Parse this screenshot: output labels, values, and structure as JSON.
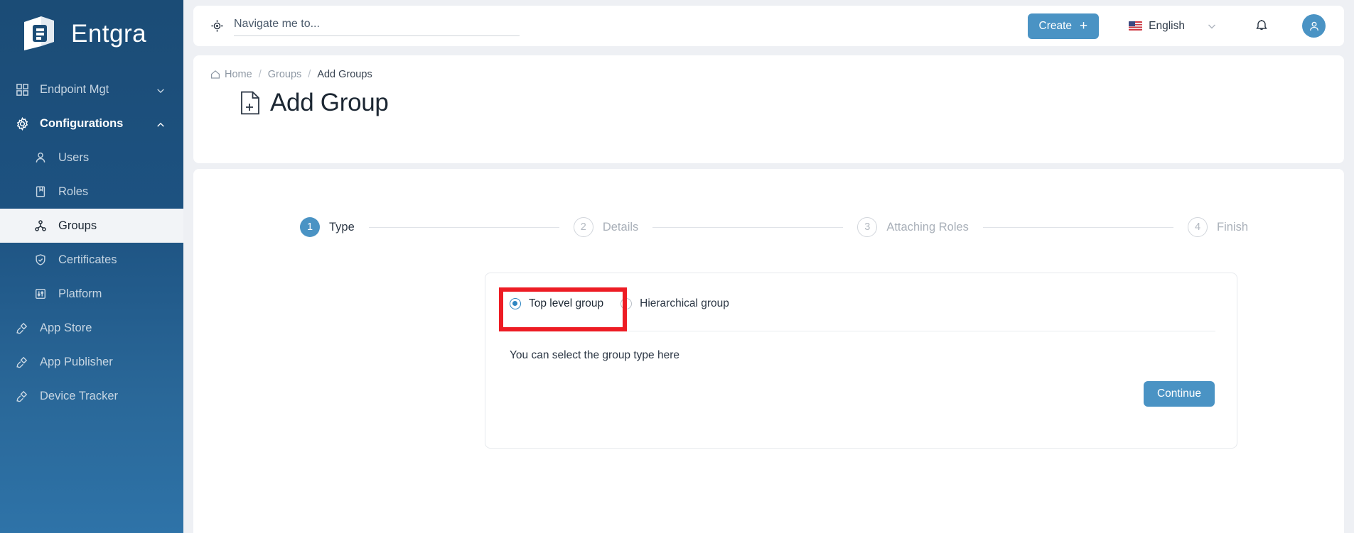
{
  "brand": {
    "name": "Entgra",
    "logo_icon": "entgra-cube-logo"
  },
  "sidebar": {
    "items": [
      {
        "label": "Endpoint Mgt",
        "icon": "grid-icon",
        "level": "top",
        "state": "collapsed",
        "chevron": "chevron-down-icon"
      },
      {
        "label": "Configurations",
        "icon": "gear-icon",
        "level": "top",
        "state": "expanded",
        "chevron": "chevron-up-icon"
      },
      {
        "label": "Users",
        "icon": "user-icon",
        "level": "sub",
        "state": "normal"
      },
      {
        "label": "Roles",
        "icon": "book-icon",
        "level": "sub",
        "state": "normal"
      },
      {
        "label": "Groups",
        "icon": "group-nodes-icon",
        "level": "sub",
        "state": "active"
      },
      {
        "label": "Certificates",
        "icon": "shield-check-icon",
        "level": "sub",
        "state": "normal"
      },
      {
        "label": "Platform",
        "icon": "sliders-icon",
        "level": "sub",
        "state": "normal"
      },
      {
        "label": "App Store",
        "icon": "plug-icon",
        "level": "top",
        "state": "normal"
      },
      {
        "label": "App Publisher",
        "icon": "plug-icon",
        "level": "top",
        "state": "normal"
      },
      {
        "label": "Device Tracker",
        "icon": "plug-icon",
        "level": "top",
        "state": "normal"
      }
    ]
  },
  "topbar": {
    "search": {
      "placeholder": "Navigate me to...",
      "value": "",
      "icon": "target-crosshair-icon"
    },
    "create_label": "Create",
    "create_plus": "+",
    "language": {
      "label": "English",
      "flag": "us-flag-icon",
      "chevron": "chevron-down-icon"
    },
    "notifications_icon": "bell-icon",
    "account_icon": "user-avatar-icon"
  },
  "header": {
    "breadcrumb": [
      {
        "label": "Home",
        "icon": "home-icon",
        "current": false
      },
      {
        "label": "Groups",
        "current": false
      },
      {
        "label": "Add Groups",
        "current": true
      }
    ],
    "separator": "/",
    "title": "Add Group",
    "title_icon": "document-plus-icon"
  },
  "wizard": {
    "steps": [
      {
        "number": "1",
        "label": "Type",
        "state": "active"
      },
      {
        "number": "2",
        "label": "Details",
        "state": "pending"
      },
      {
        "number": "3",
        "label": "Attaching Roles",
        "state": "pending"
      },
      {
        "number": "4",
        "label": "Finish",
        "state": "pending"
      }
    ]
  },
  "form": {
    "options": [
      {
        "label": "Top level group",
        "selected": true
      },
      {
        "label": "Hierarchical group",
        "selected": false
      }
    ],
    "helper_text": "You can select the group type here",
    "continue_label": "Continue"
  },
  "annotation": {
    "type": "red-highlight-box",
    "color": "#ed1c24"
  },
  "colors": {
    "accent_blue": "#4a93c4",
    "sidebar_top": "#1b4c76",
    "sidebar_bottom": "#2e73a8",
    "page_bg": "#eef0f4",
    "panel_bg": "#ffffff",
    "active_nav_bg": "#f2f4f7",
    "annotation_red": "#ed1c24"
  }
}
